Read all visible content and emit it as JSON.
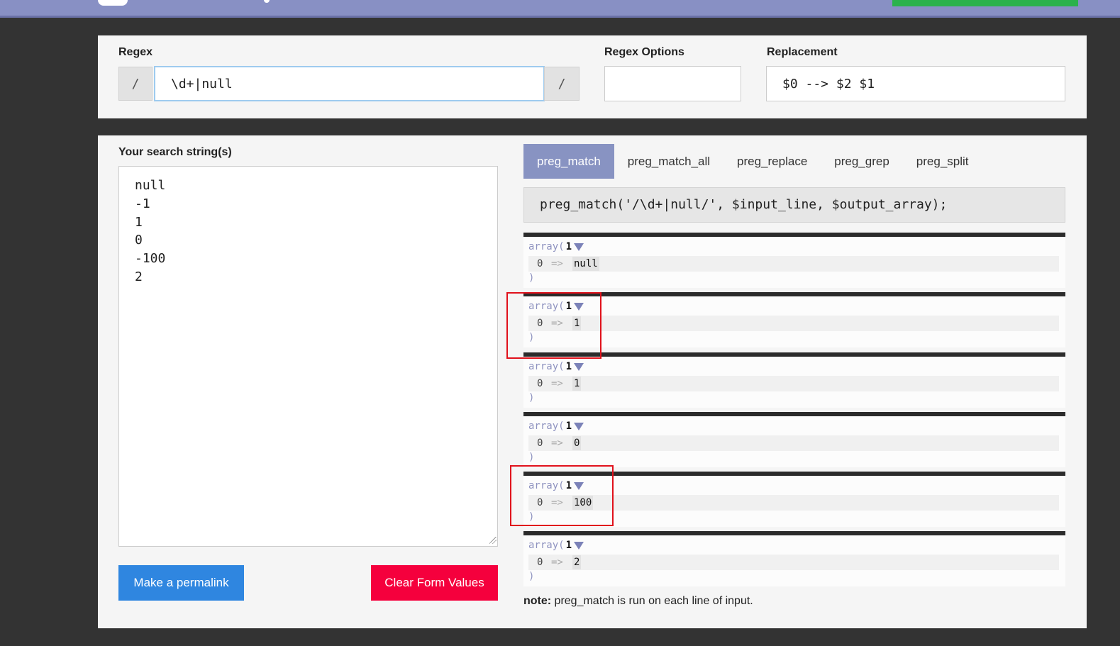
{
  "header": {},
  "regex": {
    "label": "Regex",
    "delimiter_open": "/",
    "pattern": "\\d+|null",
    "delimiter_close": "/"
  },
  "options": {
    "label": "Regex Options",
    "value": ""
  },
  "replacement": {
    "label": "Replacement",
    "value": "$0 --> $2 $1"
  },
  "search": {
    "label": "Your search string(s)",
    "text": "null\n-1\n1\n0\n-100\n2"
  },
  "buttons": {
    "permalink": "Make a permalink",
    "clear": "Clear Form Values"
  },
  "tabs": [
    {
      "label": "preg_match",
      "active": true
    },
    {
      "label": "preg_match_all",
      "active": false
    },
    {
      "label": "preg_replace",
      "active": false
    },
    {
      "label": "preg_grep",
      "active": false
    },
    {
      "label": "preg_split",
      "active": false
    }
  ],
  "code": "preg_match('/\\d+|null/', $input_line, $output_array);",
  "results": [
    {
      "array_label": "array(",
      "count": "1",
      "index": "0",
      "arrow": "=>",
      "value": "null",
      "close": ")"
    },
    {
      "array_label": "array(",
      "count": "1",
      "index": "0",
      "arrow": "=>",
      "value": "1",
      "close": ")"
    },
    {
      "array_label": "array(",
      "count": "1",
      "index": "0",
      "arrow": "=>",
      "value": "1",
      "close": ")"
    },
    {
      "array_label": "array(",
      "count": "1",
      "index": "0",
      "arrow": "=>",
      "value": "0",
      "close": ")"
    },
    {
      "array_label": "array(",
      "count": "1",
      "index": "0",
      "arrow": "=>",
      "value": "100",
      "close": ")"
    },
    {
      "array_label": "array(",
      "count": "1",
      "index": "0",
      "arrow": "=>",
      "value": "2",
      "close": ")"
    }
  ],
  "note": {
    "bold": "note:",
    "text": " preg_match is run on each line of input."
  },
  "colors": {
    "background": "#333333",
    "topbar": "#8890c4",
    "panel": "#f5f5f5",
    "active_tab": "#8893c2",
    "permalink_button": "#2f86e0",
    "clear_button": "#f5003d",
    "annotation": "#e0111b"
  }
}
